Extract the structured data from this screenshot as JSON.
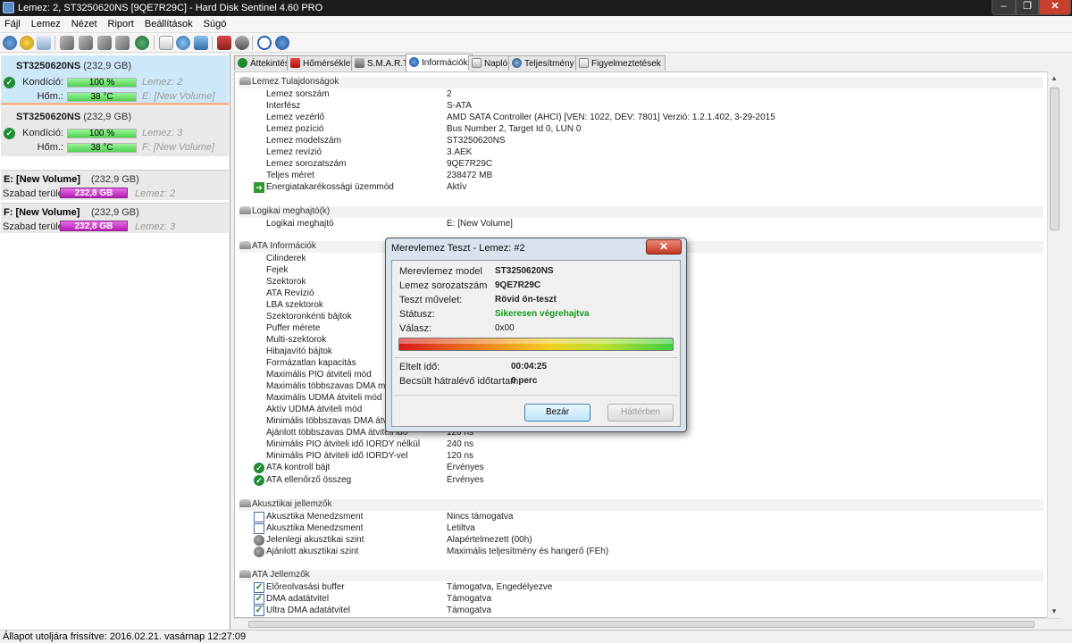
{
  "window": {
    "title": "Lemez: 2, ST3250620NS [9QE7R29C]  -  Hard Disk Sentinel 4.60 PRO",
    "min": "–",
    "max": "❐",
    "close": "✕"
  },
  "menu": [
    "Fájl",
    "Lemez",
    "Nézet",
    "Riport",
    "Beállítások",
    "Súgó"
  ],
  "left": {
    "disks": [
      {
        "name": "ST3250620NS",
        "size": "(232,9 GB)",
        "cond_label": "Kondíció:",
        "cond_value": "100 %",
        "cond_fill": 1.0,
        "disk_ref": "Lemez: 2",
        "temp_label": "Hőm.:",
        "temp_value": "38 °C",
        "temp_fill": 1.0,
        "vol_ref": "E: [New Volume]"
      },
      {
        "name": "ST3250620NS",
        "size": "(232,9 GB)",
        "cond_label": "Kondíció:",
        "cond_value": "100 %",
        "cond_fill": 1.0,
        "disk_ref": "Lemez: 3",
        "temp_label": "Hőm.:",
        "temp_value": "38 °C",
        "temp_fill": 1.0,
        "vol_ref": "F: [New Volume]"
      }
    ],
    "volumes": [
      {
        "name": "E: [New Volume]",
        "size": "(232,9 GB)",
        "free_label": "Szabad terület",
        "free_value": "232,8 GB",
        "disk_ref": "Lemez: 2"
      },
      {
        "name": "F: [New Volume]",
        "size": "(232,9 GB)",
        "free_label": "Szabad terület",
        "free_value": "232,8 GB",
        "disk_ref": "Lemez: 3"
      }
    ]
  },
  "tabs": [
    "Áttekintés",
    "Hőmérséklet",
    "S.M.A.R.T.",
    "Információk",
    "Napló",
    "Teljesítmény",
    "Figyelmeztetések"
  ],
  "info": {
    "sec1": {
      "title": "Lemez Tulajdonságok",
      "rows": [
        {
          "k": "Lemez sorszám",
          "v": "2"
        },
        {
          "k": "Interfész",
          "v": "S-ATA"
        },
        {
          "k": "Lemez vezérlő",
          "v": "AMD SATA Controller (AHCI) [VEN: 1022, DEV: 7801] Verzió: 1.2.1.402, 3-29-2015"
        },
        {
          "k": "Lemez pozíció",
          "v": "Bus Number 2, Target Id 0, LUN 0"
        },
        {
          "k": "Lemez modelszám",
          "v": "ST3250620NS"
        },
        {
          "k": "Lemez revízió",
          "v": "3.AEK"
        },
        {
          "k": "Lemez sorozatszám",
          "v": "9QE7R29C"
        },
        {
          "k": "Teljes méret",
          "v": "238472 MB"
        },
        {
          "k": "Energiatakarékossági üzemmód",
          "v": "Aktív"
        }
      ]
    },
    "sec2": {
      "title": "Logikai meghajtó(k)",
      "rows": [
        {
          "k": "Logikai meghajtó",
          "v": "E: [New Volume]"
        }
      ]
    },
    "sec3": {
      "title": "ATA Információk",
      "rows": [
        {
          "k": "Cilinderek",
          "v": ""
        },
        {
          "k": "Fejek",
          "v": ""
        },
        {
          "k": "Szektorok",
          "v": ""
        },
        {
          "k": "ATA Revízió",
          "v": ""
        },
        {
          "k": "LBA szektorok",
          "v": ""
        },
        {
          "k": "Szektoronkénti bájtok",
          "v": ""
        },
        {
          "k": "Puffer mérete",
          "v": ""
        },
        {
          "k": "Multi-szektorok",
          "v": ""
        },
        {
          "k": "Hibajavító bájtok",
          "v": ""
        },
        {
          "k": "Formázatlan kapacitás",
          "v": ""
        },
        {
          "k": "Maximális PIO átviteli mód",
          "v": ""
        },
        {
          "k": "Maximális többszavas DMA mód",
          "v": ""
        },
        {
          "k": "Maximális UDMA átviteli mód",
          "v": ""
        },
        {
          "k": "Aktív UDMA átviteli mód",
          "v": ""
        },
        {
          "k": "Minimális többszavas DMA átviteli idő",
          "v": ""
        },
        {
          "k": "Ajánlott többszavas DMA átviteli idő",
          "v": "120 ns"
        },
        {
          "k": "Minimális PIO átviteli idő IORDY nélkül",
          "v": "240 ns"
        },
        {
          "k": "Minimális PIO átviteli idő IORDY-vel",
          "v": "120 ns"
        },
        {
          "k": "ATA kontroll bájt",
          "v": "Érvényes"
        },
        {
          "k": "ATA ellenőrző összeg",
          "v": "Érvényes"
        }
      ]
    },
    "sec4": {
      "title": "Akusztikai jellemzők",
      "rows": [
        {
          "k": "Akusztika Menedzsment",
          "v": "Nincs támogatva"
        },
        {
          "k": "Akusztika Menedzsment",
          "v": "Letiltva"
        },
        {
          "k": "Jelenlegi akusztikai szint",
          "v": "Alapértelmezett (00h)"
        },
        {
          "k": "Ajánlott akusztikai szint",
          "v": "Maximális teljesítmény és hangerő (FEh)"
        }
      ]
    },
    "sec5": {
      "title": "ATA Jellemzők",
      "rows": [
        {
          "k": "Előreolvasási buffer",
          "v": "Támogatva, Engedélyezve"
        },
        {
          "k": "DMA adatátvitel",
          "v": "Támogatva"
        },
        {
          "k": "Ultra DMA adatátvitel",
          "v": "Támogatva"
        }
      ]
    }
  },
  "dialog": {
    "title": "Merevlemez Teszt - Lemez: #2",
    "close": "✕",
    "model_label": "Merevlemez model",
    "model_value": "ST3250620NS",
    "serial_label": "Lemez sorozatszám",
    "serial_value": "9QE7R29C",
    "op_label": "Teszt művelet:",
    "op_value": "Rövid ön-teszt",
    "status_label": "Státusz:",
    "status_value": "Sikeresen végrehajtva",
    "resp_label": "Válasz:",
    "resp_value": "0x00",
    "progress": 1.0,
    "elapsed_label": "Eltelt idő:",
    "elapsed_value": "00:04:25",
    "remaining_label": "Becsült hátralévő időtartam:",
    "remaining_value": "0 perc",
    "btn_close": "Bezár",
    "btn_background": "Háttérben"
  },
  "status": "Állapot utoljára frissítve: 2016.02.21. vasárnap 12:27:09",
  "colors": {
    "ok_green": "#1d8d2f",
    "status_green": "#14991d",
    "free_space_magenta": "#d040d0",
    "selected_disk_bg": "#cde8f8"
  }
}
